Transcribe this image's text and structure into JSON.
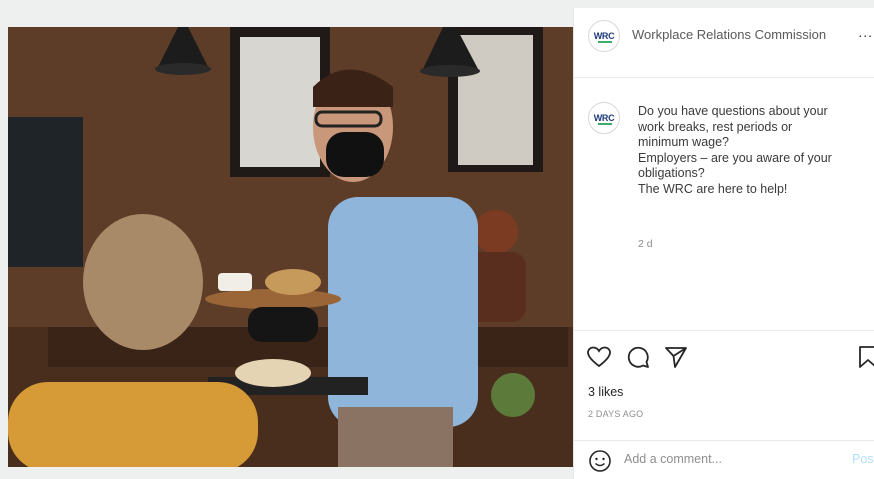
{
  "post": {
    "account_name": "Workplace Relations Commission",
    "avatar_text": "WRC",
    "more_label": "...",
    "caption_lines": [
      "Do you have questions about your",
      "work breaks, rest periods or",
      "minimum wage?",
      "Employers – are you aware of your",
      "obligations?",
      "The WRC are here to help!"
    ],
    "relative_time": "2 d",
    "likes": "3 likes",
    "posted_ago": "2 DAYS AGO",
    "comment_placeholder": "Add a comment...",
    "post_label": "Post"
  },
  "icons": {
    "like": "heart-icon",
    "comment": "comment-icon",
    "share": "send-icon",
    "save": "bookmark-icon",
    "emoji": "emoji-icon"
  },
  "colors": {
    "post_button": "#b2dffc",
    "wrc_blue": "#1e3a7a",
    "wrc_green": "#3cae6b"
  }
}
